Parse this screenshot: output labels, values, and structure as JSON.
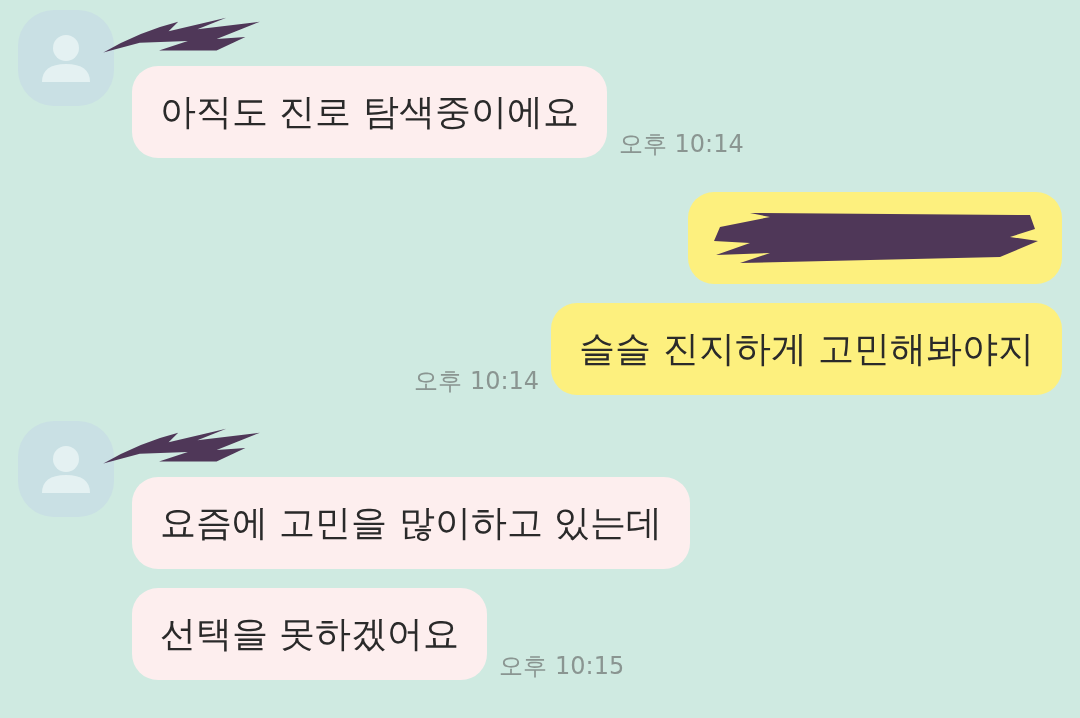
{
  "messages": [
    {
      "outgoing": false,
      "name_redacted": true,
      "bubbles": [
        {
          "kind": "text",
          "text": "아직도 진로 탐색중이에요",
          "time": "오후 10:14"
        }
      ]
    },
    {
      "outgoing": true,
      "bubbles": [
        {
          "kind": "redacted"
        },
        {
          "kind": "text",
          "text": "슬슬 진지하게 고민해봐야지",
          "time": "오후 10:14"
        }
      ]
    },
    {
      "outgoing": false,
      "name_redacted": true,
      "bubbles": [
        {
          "kind": "text",
          "text": "요즘에 고민을 많이하고 있는데"
        },
        {
          "kind": "text",
          "text": "선택을 못하겠어요",
          "time": "오후 10:15"
        }
      ]
    }
  ]
}
